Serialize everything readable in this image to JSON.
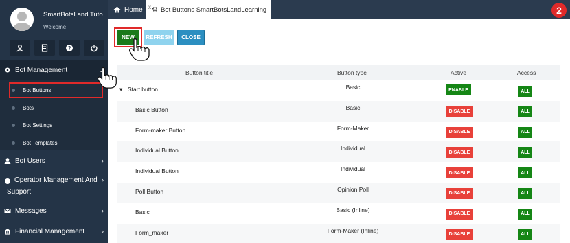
{
  "sidebar": {
    "profile_name": "SmartBotsLand Tuto",
    "profile_welcome": "Welcome",
    "profile_icons": [
      "user-icon",
      "document-icon",
      "help-icon",
      "power-icon"
    ],
    "menu": {
      "bot_management": "Bot Management",
      "bot_users": "Bot Users",
      "operator_line1": "Operator Management And",
      "operator_line2": "Support",
      "messages": "Messages",
      "financial": "Financial Management"
    },
    "submenu": [
      "Bot Buttons",
      "Bots",
      "Bot Settings",
      "Bot Templates"
    ]
  },
  "tabs": {
    "home": "Home",
    "active": "Bot Buttons SmartBotsLandLearning",
    "close_mark": "x"
  },
  "step_badge": "2",
  "toolbar": {
    "new": "NEW",
    "refresh": "REFRESH",
    "close": "CLOSE"
  },
  "table": {
    "headers": {
      "title": "Button title",
      "type": "Button type",
      "active": "Active",
      "access": "Access"
    },
    "rows": [
      {
        "title": "Start button",
        "type": "Basic",
        "active": "ENABLE",
        "access": "ALL",
        "expand": "▾"
      },
      {
        "title": "Basic Button",
        "type": "Basic",
        "active": "DISABLE",
        "access": "ALL"
      },
      {
        "title": "Form-maker Button",
        "type": "Form-Maker",
        "active": "DISABLE",
        "access": "ALL"
      },
      {
        "title": "Individual Button",
        "type": "Individual",
        "active": "DISABLE",
        "access": "ALL"
      },
      {
        "title": "Individual Button",
        "type": "Individual",
        "active": "DISABLE",
        "access": "ALL"
      },
      {
        "title": "Poll Button",
        "type": "Opinion Poll",
        "active": "DISABLE",
        "access": "ALL"
      },
      {
        "title": "Basic",
        "type": "Basic (Inline)",
        "active": "DISABLE",
        "access": "ALL"
      },
      {
        "title": "Form_maker",
        "type": "Form-Maker (Inline)",
        "active": "DISABLE",
        "access": "ALL"
      }
    ]
  },
  "colors": {
    "sidebar": "#243447",
    "enable": "#158615",
    "disable": "#e8413a",
    "highlight": "#e02a2a"
  }
}
